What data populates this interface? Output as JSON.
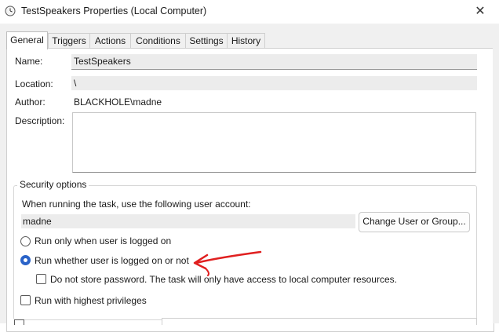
{
  "window": {
    "title": "TestSpeakers Properties (Local Computer)",
    "close_glyph": "✕"
  },
  "tabs": [
    {
      "label": "General",
      "active": true
    },
    {
      "label": "Triggers",
      "active": false
    },
    {
      "label": "Actions",
      "active": false
    },
    {
      "label": "Conditions",
      "active": false
    },
    {
      "label": "Settings",
      "active": false
    },
    {
      "label": "History",
      "active": false
    }
  ],
  "general": {
    "name_label": "Name:",
    "name_value": "TestSpeakers",
    "location_label": "Location:",
    "location_value": "\\",
    "author_label": "Author:",
    "author_value": "BLACKHOLE\\madne",
    "description_label": "Description:",
    "description_value": ""
  },
  "security": {
    "group_title": "Security options",
    "account_prompt": "When running the task, use the following user account:",
    "account_value": "madne",
    "change_button": "Change User or Group...",
    "radio_logged_on": "Run only when user is logged on",
    "radio_whether": "Run whether user is logged on or not",
    "selected_radio": "radio_whether",
    "no_store_password": "Do not store password.  The task will only have access to local computer resources.",
    "no_store_password_checked": false,
    "highest_privileges": "Run with highest privileges",
    "highest_privileges_checked": false
  },
  "colors": {
    "accent": "#2a63c8",
    "annotation": "#e02020"
  }
}
